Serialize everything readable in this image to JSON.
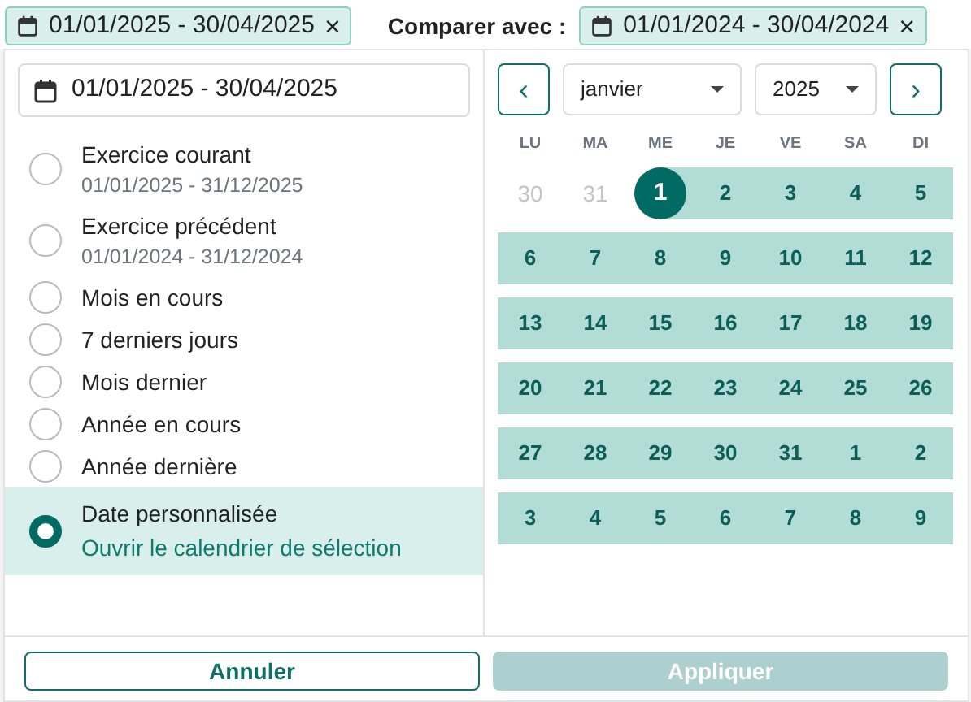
{
  "filter_chip": {
    "label": "01/01/2025 - 30/04/2025",
    "close": "×"
  },
  "compare": {
    "label": "Comparer avec :",
    "chip": {
      "label": "01/01/2024 - 30/04/2024",
      "close": "×"
    }
  },
  "range_field": {
    "value": "01/01/2025 - 30/04/2025"
  },
  "presets": [
    {
      "label": "Exercice courant",
      "sub": "01/01/2025 - 31/12/2025",
      "selected": false
    },
    {
      "label": "Exercice précédent",
      "sub": "01/01/2024 - 31/12/2024",
      "selected": false
    },
    {
      "label": "Mois en cours",
      "selected": false
    },
    {
      "label": "7 derniers jours",
      "selected": false
    },
    {
      "label": "Mois dernier",
      "selected": false
    },
    {
      "label": "Année en cours",
      "selected": false
    },
    {
      "label": "Année dernière",
      "selected": false
    },
    {
      "label": "Date personnalisée",
      "link": "Ouvrir le calendrier de sélection",
      "selected": true
    }
  ],
  "calendar": {
    "prev": "‹",
    "next": "›",
    "month": "janvier",
    "year": "2025",
    "weekdays": [
      "LU",
      "MA",
      "ME",
      "JE",
      "VE",
      "SA",
      "DI"
    ],
    "weeks": [
      [
        {
          "day": "30",
          "muted": true,
          "in_range": false,
          "selected": false
        },
        {
          "day": "31",
          "muted": true,
          "in_range": false,
          "selected": false
        },
        {
          "day": "1",
          "muted": false,
          "in_range": true,
          "selected": true
        },
        {
          "day": "2",
          "muted": false,
          "in_range": true,
          "selected": false
        },
        {
          "day": "3",
          "muted": false,
          "in_range": true,
          "selected": false
        },
        {
          "day": "4",
          "muted": false,
          "in_range": true,
          "selected": false
        },
        {
          "day": "5",
          "muted": false,
          "in_range": true,
          "selected": false
        }
      ],
      [
        {
          "day": "6",
          "muted": false,
          "in_range": true,
          "selected": false
        },
        {
          "day": "7",
          "muted": false,
          "in_range": true,
          "selected": false
        },
        {
          "day": "8",
          "muted": false,
          "in_range": true,
          "selected": false
        },
        {
          "day": "9",
          "muted": false,
          "in_range": true,
          "selected": false
        },
        {
          "day": "10",
          "muted": false,
          "in_range": true,
          "selected": false
        },
        {
          "day": "11",
          "muted": false,
          "in_range": true,
          "selected": false
        },
        {
          "day": "12",
          "muted": false,
          "in_range": true,
          "selected": false
        }
      ],
      [
        {
          "day": "13",
          "muted": false,
          "in_range": true,
          "selected": false
        },
        {
          "day": "14",
          "muted": false,
          "in_range": true,
          "selected": false
        },
        {
          "day": "15",
          "muted": false,
          "in_range": true,
          "selected": false
        },
        {
          "day": "16",
          "muted": false,
          "in_range": true,
          "selected": false
        },
        {
          "day": "17",
          "muted": false,
          "in_range": true,
          "selected": false
        },
        {
          "day": "18",
          "muted": false,
          "in_range": true,
          "selected": false
        },
        {
          "day": "19",
          "muted": false,
          "in_range": true,
          "selected": false
        }
      ],
      [
        {
          "day": "20",
          "muted": false,
          "in_range": true,
          "selected": false
        },
        {
          "day": "21",
          "muted": false,
          "in_range": true,
          "selected": false
        },
        {
          "day": "22",
          "muted": false,
          "in_range": true,
          "selected": false
        },
        {
          "day": "23",
          "muted": false,
          "in_range": true,
          "selected": false
        },
        {
          "day": "24",
          "muted": false,
          "in_range": true,
          "selected": false
        },
        {
          "day": "25",
          "muted": false,
          "in_range": true,
          "selected": false
        },
        {
          "day": "26",
          "muted": false,
          "in_range": true,
          "selected": false
        }
      ],
      [
        {
          "day": "27",
          "muted": false,
          "in_range": true,
          "selected": false
        },
        {
          "day": "28",
          "muted": false,
          "in_range": true,
          "selected": false
        },
        {
          "day": "29",
          "muted": false,
          "in_range": true,
          "selected": false
        },
        {
          "day": "30",
          "muted": false,
          "in_range": true,
          "selected": false
        },
        {
          "day": "31",
          "muted": false,
          "in_range": true,
          "selected": false
        },
        {
          "day": "1",
          "muted": false,
          "in_range": true,
          "selected": false
        },
        {
          "day": "2",
          "muted": false,
          "in_range": true,
          "selected": false
        }
      ],
      [
        {
          "day": "3",
          "muted": false,
          "in_range": true,
          "selected": false
        },
        {
          "day": "4",
          "muted": false,
          "in_range": true,
          "selected": false
        },
        {
          "day": "5",
          "muted": false,
          "in_range": true,
          "selected": false
        },
        {
          "day": "6",
          "muted": false,
          "in_range": true,
          "selected": false
        },
        {
          "day": "7",
          "muted": false,
          "in_range": true,
          "selected": false
        },
        {
          "day": "8",
          "muted": false,
          "in_range": true,
          "selected": false
        },
        {
          "day": "9",
          "muted": false,
          "in_range": true,
          "selected": false
        }
      ]
    ]
  },
  "buttons": [
    {
      "label": "Annuler",
      "kind": "outline",
      "disabled": false
    },
    {
      "label": "Appliquer",
      "kind": "primary",
      "disabled": true
    }
  ]
}
